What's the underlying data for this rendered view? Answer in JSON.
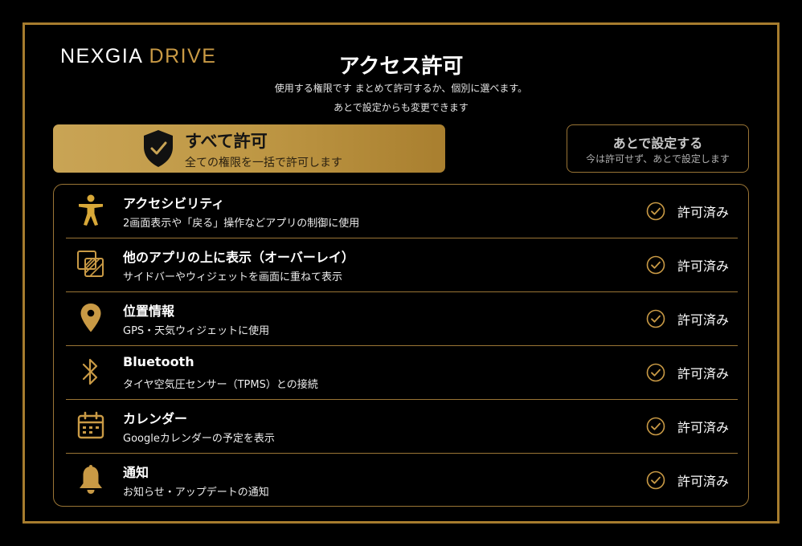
{
  "brand": {
    "logo_white": "NEXGIA",
    "logo_gold": "DRIVE"
  },
  "header": {
    "title": "アクセス許可",
    "subtitle_line1": "使用する権限です まとめて許可するか、個別に選べます。",
    "subtitle_line2": "あとで設定からも変更できます"
  },
  "actions": {
    "allow_all": {
      "label": "すべて許可",
      "description": "全ての権限を一括で許可します"
    },
    "later": {
      "label": "あとで設定する",
      "description": "今は許可せず、あとで設定します"
    }
  },
  "permissions": [
    {
      "icon": "accessibility-icon",
      "label": "アクセシビリティ",
      "description": "2画面表示や「戻る」操作などアプリの制御に使用",
      "status": "許可済み"
    },
    {
      "icon": "overlay-icon",
      "label": "他のアプリの上に表示（オーバーレイ）",
      "description": "サイドバーやウィジェットを画面に重ねて表示",
      "status": "許可済み"
    },
    {
      "icon": "location-pin-icon",
      "label": "位置情報",
      "description": "GPS・天気ウィジェットに使用",
      "status": "許可済み"
    },
    {
      "icon": "bluetooth-icon",
      "label": "Bluetooth",
      "description": "タイヤ空気圧センサー（TPMS）との接続",
      "status": "許可済み"
    },
    {
      "icon": "calendar-icon",
      "label": "カレンダー",
      "description": "Googleカレンダーの予定を表示",
      "status": "許可済み"
    },
    {
      "icon": "bell-icon",
      "label": "通知",
      "description": "お知らせ・アップデートの通知",
      "status": "許可済み"
    }
  ],
  "colors": {
    "gold": "#c99a45",
    "frame": "#a67c2e",
    "background": "#000000"
  }
}
